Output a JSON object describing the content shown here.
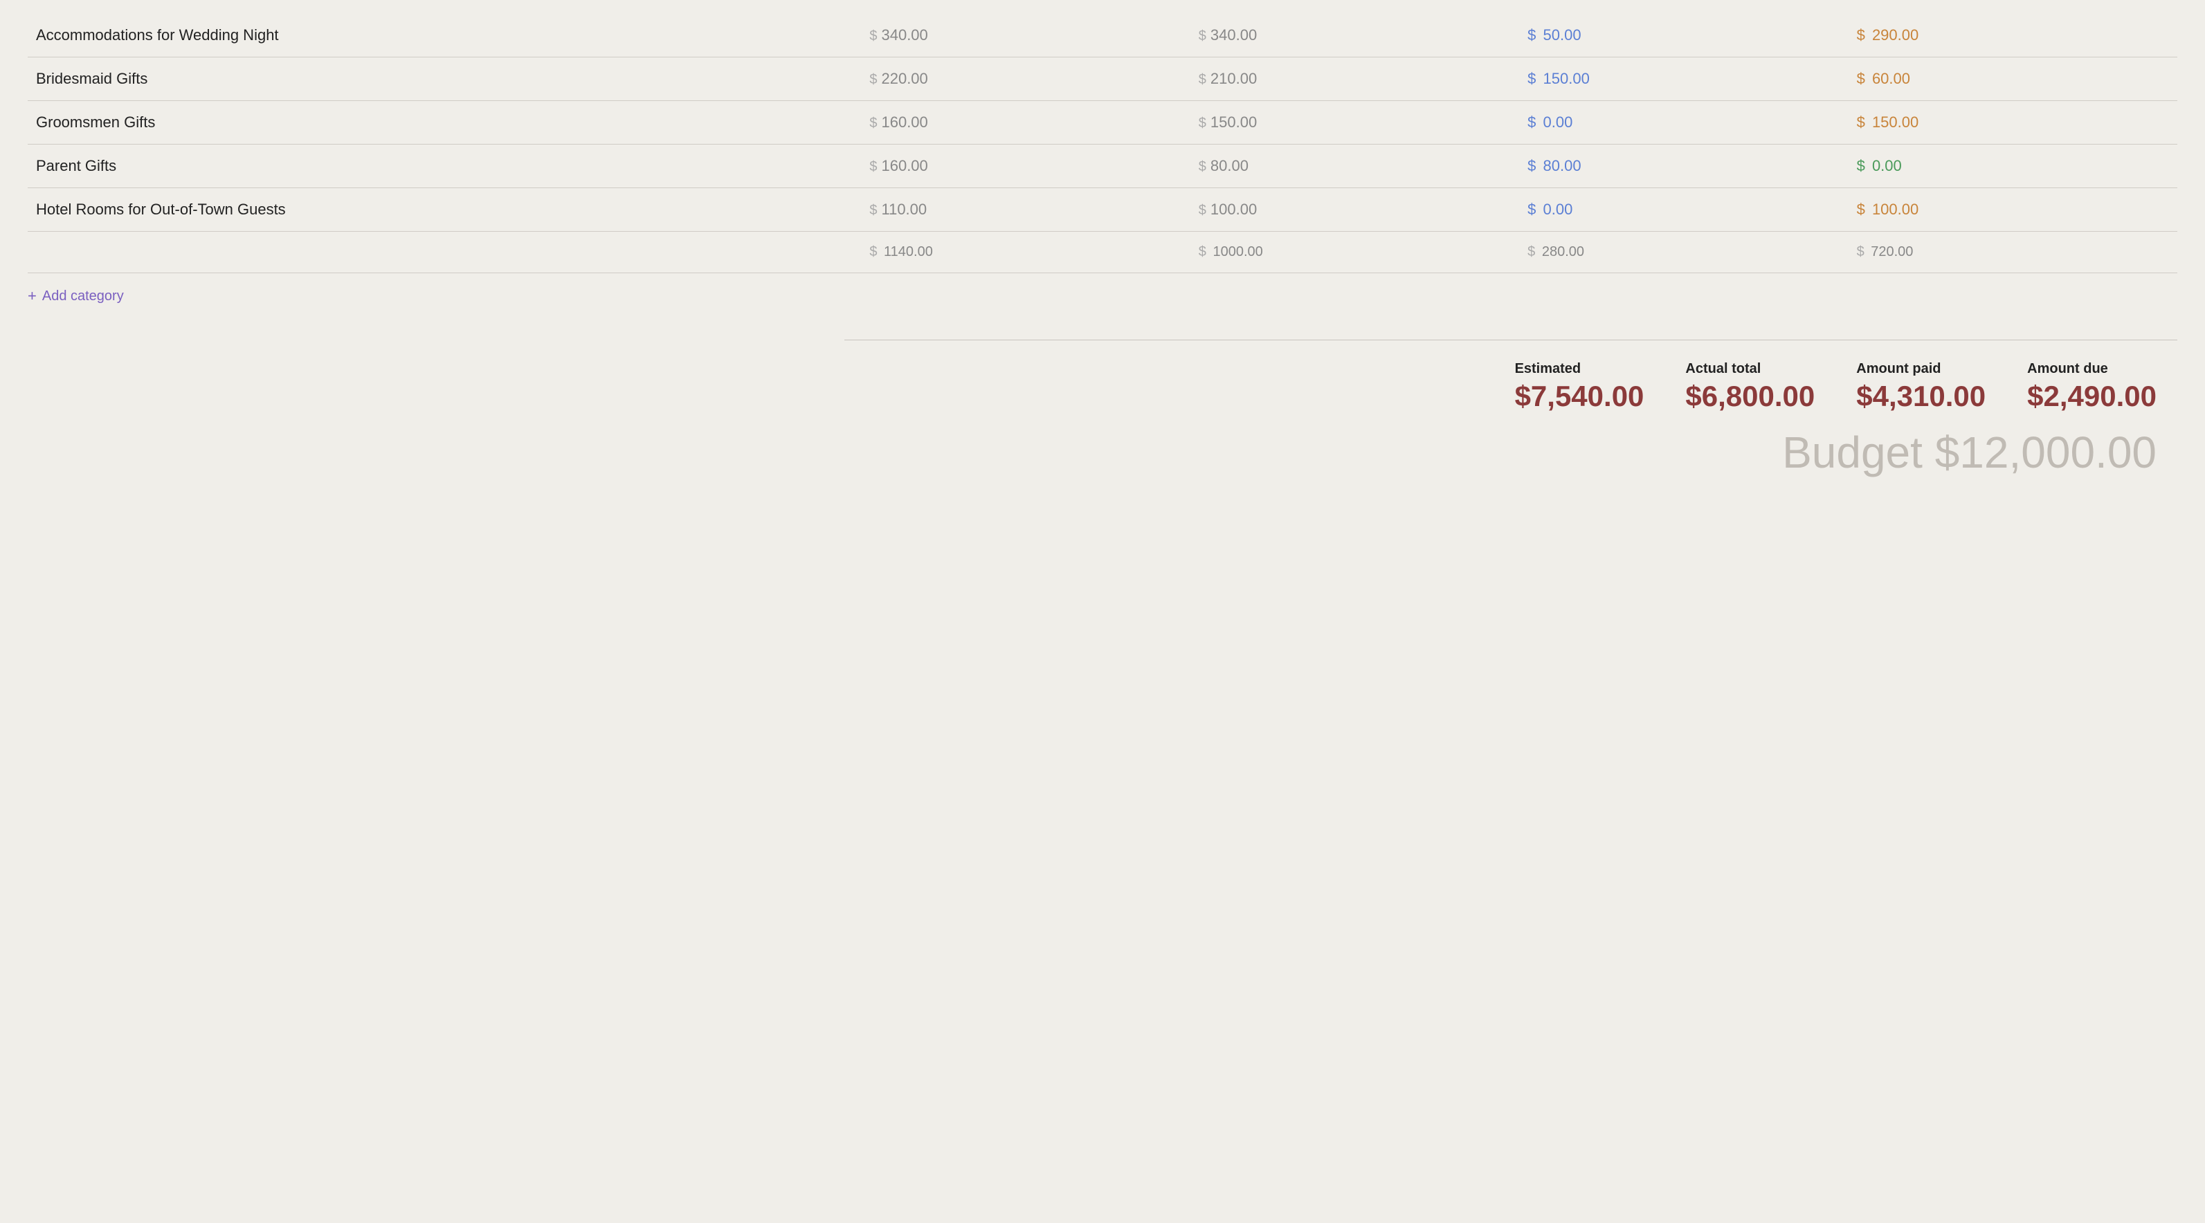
{
  "table": {
    "rows": [
      {
        "name": "Accommodations for Wedding Night",
        "estimated": "340.00",
        "actual": "340.00",
        "paid": "50.00",
        "due": "290.00",
        "due_color": "orange"
      },
      {
        "name": "Bridesmaid Gifts",
        "estimated": "220.00",
        "actual": "210.00",
        "paid": "150.00",
        "due": "60.00",
        "due_color": "orange"
      },
      {
        "name": "Groomsmen Gifts",
        "estimated": "160.00",
        "actual": "150.00",
        "paid": "0.00",
        "due": "150.00",
        "due_color": "orange"
      },
      {
        "name": "Parent Gifts",
        "estimated": "160.00",
        "actual": "80.00",
        "paid": "80.00",
        "due": "0.00",
        "due_color": "green"
      },
      {
        "name": "Hotel Rooms for Out-of-Town Guests",
        "estimated": "110.00",
        "actual": "100.00",
        "paid": "0.00",
        "due": "100.00",
        "due_color": "orange"
      }
    ],
    "totals": {
      "estimated": "1140.00",
      "actual": "1000.00",
      "paid": "280.00",
      "due": "720.00"
    }
  },
  "add_category": {
    "label": "Add category"
  },
  "summary": {
    "items": [
      {
        "label": "Estimated",
        "value": "$7,540.00"
      },
      {
        "label": "Actual total",
        "value": "$6,800.00"
      },
      {
        "label": "Amount paid",
        "value": "$4,310.00"
      },
      {
        "label": "Amount due",
        "value": "$2,490.00"
      }
    ]
  },
  "budget_total": {
    "label": "Budget $12,000.00"
  },
  "colors": {
    "paid": "#5b7fd4",
    "due_orange": "#c8843a",
    "due_green": "#4a9a5a",
    "add_category": "#7a5fc0",
    "summary_value": "#8b3a3a",
    "budget_total": "#c0bbb4"
  },
  "icons": {
    "plus": "+",
    "dollar": "$"
  }
}
